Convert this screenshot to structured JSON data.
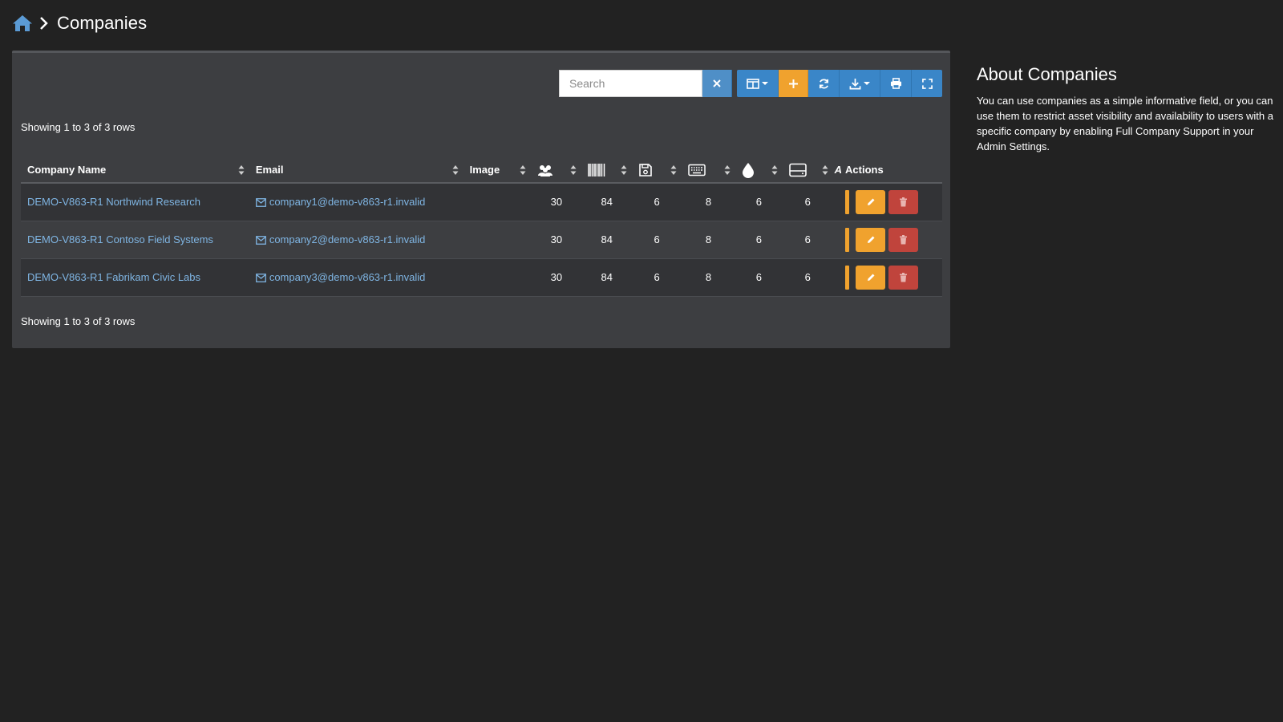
{
  "breadcrumb": {
    "title": "Companies"
  },
  "toolbar": {
    "search_placeholder": "Search"
  },
  "status": {
    "showing_top": "Showing 1 to 3 of 3 rows",
    "showing_bottom": "Showing 1 to 3 of 3 rows"
  },
  "table": {
    "headers": {
      "company_name": "Company Name",
      "email": "Email",
      "image": "Image",
      "truncated": "A",
      "actions": "Actions"
    },
    "header_icons": [
      "users-icon",
      "barcode-icon",
      "save-icon",
      "keyboard-icon",
      "droplet-icon",
      "hdd-icon"
    ],
    "rows": [
      {
        "name": "DEMO-V863-R1 Northwind Research",
        "email": "company1@demo-v863-r1.invalid",
        "users": "30",
        "assets": "84",
        "licenses": "6",
        "accessories": "8",
        "consumables": "6",
        "components": "6"
      },
      {
        "name": "DEMO-V863-R1 Contoso Field Systems",
        "email": "company2@demo-v863-r1.invalid",
        "users": "30",
        "assets": "84",
        "licenses": "6",
        "accessories": "8",
        "consumables": "6",
        "components": "6"
      },
      {
        "name": "DEMO-V863-R1 Fabrikam Civic Labs",
        "email": "company3@demo-v863-r1.invalid",
        "users": "30",
        "assets": "84",
        "licenses": "6",
        "accessories": "8",
        "consumables": "6",
        "components": "6"
      }
    ]
  },
  "about": {
    "title": "About Companies",
    "body": "You can use companies as a simple informative field, or you can use them to restrict asset visibility and availability to users with a specific company by enabling Full Company Support in your Admin Settings."
  },
  "colors": {
    "background": "#222222",
    "panel": "#3d3e41",
    "link": "#7fb5e3",
    "primary": "#3a86c8",
    "warning": "#f0a22e",
    "danger": "#c0443c"
  }
}
